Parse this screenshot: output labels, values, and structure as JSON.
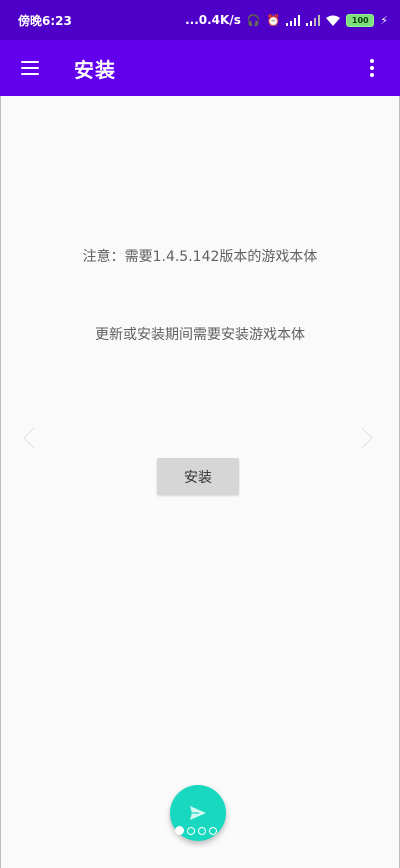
{
  "status_bar": {
    "time": "傍晚6:23",
    "speed": "...0.4K/s",
    "battery": "100"
  },
  "app_bar": {
    "title": "安装"
  },
  "main": {
    "notice_version": "注意：需要1.4.5.142版本的游戏本体",
    "notice_update": "更新或安装期间需要安装游戏本体",
    "install_button": "安装"
  },
  "pager": {
    "pages": 4,
    "active_index": 0
  },
  "colors": {
    "status_bar": "#4e00c8",
    "app_bar": "#6200ee",
    "fab": "#19d8c0",
    "button": "#d6d6d6"
  }
}
